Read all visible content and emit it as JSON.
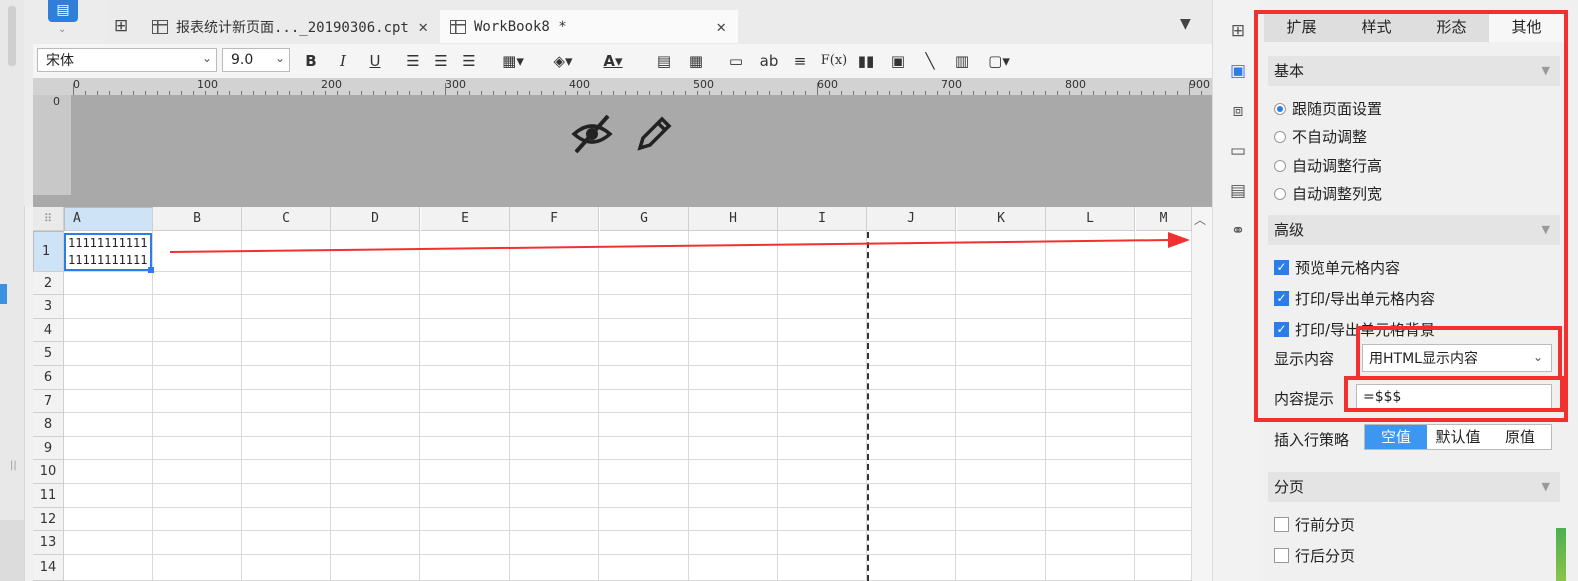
{
  "tabs": [
    {
      "label": "报表统计新页面..._20190306.cpt",
      "close": "✕",
      "active": false
    },
    {
      "label": "WorkBook8 *",
      "close": "✕",
      "active": true
    }
  ],
  "toolbar": {
    "font_family": "宋体",
    "font_size": "9.0",
    "bold": "B",
    "italic": "I",
    "underline": "U",
    "text_btn": "ab",
    "formula_btn": "F(x)"
  },
  "ruler": {
    "labels": [
      "0",
      "100",
      "200",
      "300",
      "400",
      "500",
      "600",
      "700",
      "800",
      "900"
    ],
    "vertical_label": "0"
  },
  "sheet": {
    "columns": [
      "A",
      "B",
      "C",
      "D",
      "E",
      "F",
      "G",
      "H",
      "I",
      "J",
      "K",
      "L",
      "M"
    ],
    "rows": [
      "1",
      "2",
      "3",
      "4",
      "5",
      "6",
      "7",
      "8",
      "9",
      "10",
      "11",
      "12",
      "13",
      "14"
    ],
    "selected_cell": "A1",
    "cell_a1_line1": "11111111111",
    "cell_a1_line2": "11111111111"
  },
  "property_panel": {
    "tabs": [
      "扩展",
      "样式",
      "形态",
      "其他"
    ],
    "active_tab": "其他",
    "basic": {
      "title": "基本",
      "options": [
        "跟随页面设置",
        "不自动调整",
        "自动调整行高",
        "自动调整列宽"
      ],
      "selected": "跟随页面设置"
    },
    "advanced": {
      "title": "高级",
      "checks": [
        "预览单元格内容",
        "打印/导出单元格内容",
        "打印/导出单元格背景"
      ],
      "display_label": "显示内容",
      "display_value": "用HTML显示内容",
      "tooltip_label": "内容提示",
      "tooltip_value": "=$$$",
      "insert_label": "插入行策略",
      "insert_options": [
        "空值",
        "默认值",
        "原值"
      ],
      "insert_selected": "空值"
    },
    "paging": {
      "title": "分页",
      "checks": [
        "行前分页",
        "行后分页"
      ]
    }
  },
  "colors": {
    "accent": "#2b7de9",
    "annotation_red": "#f23030"
  }
}
